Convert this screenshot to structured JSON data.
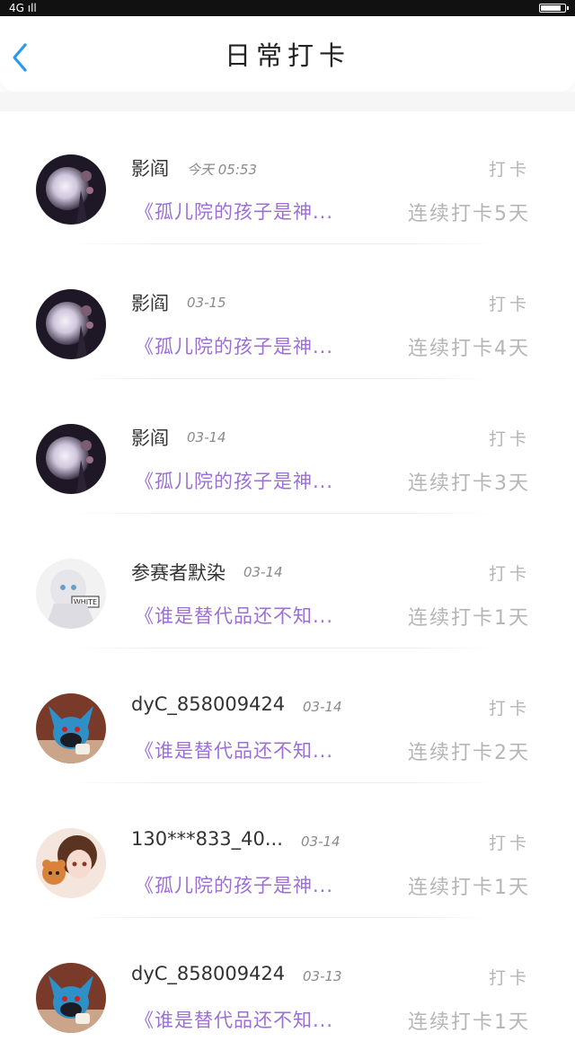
{
  "status_bar": {
    "left": "4G ıll",
    "time": "",
    "right": ""
  },
  "header": {
    "title": "日常打卡"
  },
  "checkins": [
    {
      "user": "影阎",
      "time": "今天 05:53",
      "action": "打卡",
      "book": "《孤儿院的孩子是神...",
      "streak": "连续打卡5天",
      "avatar": "moon"
    },
    {
      "user": "影阎",
      "time": "03-15",
      "action": "打卡",
      "book": "《孤儿院的孩子是神...",
      "streak": "连续打卡4天",
      "avatar": "moon"
    },
    {
      "user": "影阎",
      "time": "03-14",
      "action": "打卡",
      "book": "《孤儿院的孩子是神...",
      "streak": "连续打卡3天",
      "avatar": "moon"
    },
    {
      "user": "参赛者默染",
      "time": "03-14",
      "action": "打卡",
      "book": "《谁是替代品还不知...",
      "streak": "连续打卡1天",
      "avatar": "white"
    },
    {
      "user": "dyC_858009424",
      "time": "03-14",
      "action": "打卡",
      "book": "《谁是替代品还不知...",
      "streak": "连续打卡2天",
      "avatar": "lucario"
    },
    {
      "user": "130***833_40...",
      "time": "03-14",
      "action": "打卡",
      "book": "《孤儿院的孩子是神...",
      "streak": "连续打卡1天",
      "avatar": "girl"
    },
    {
      "user": "dyC_858009424",
      "time": "03-13",
      "action": "打卡",
      "book": "《谁是替代品还不知...",
      "streak": "连续打卡1天",
      "avatar": "lucario"
    }
  ],
  "colors": {
    "accent": "#9b6fd4",
    "back": "#2a9af0",
    "muted": "#b5b5b5"
  }
}
